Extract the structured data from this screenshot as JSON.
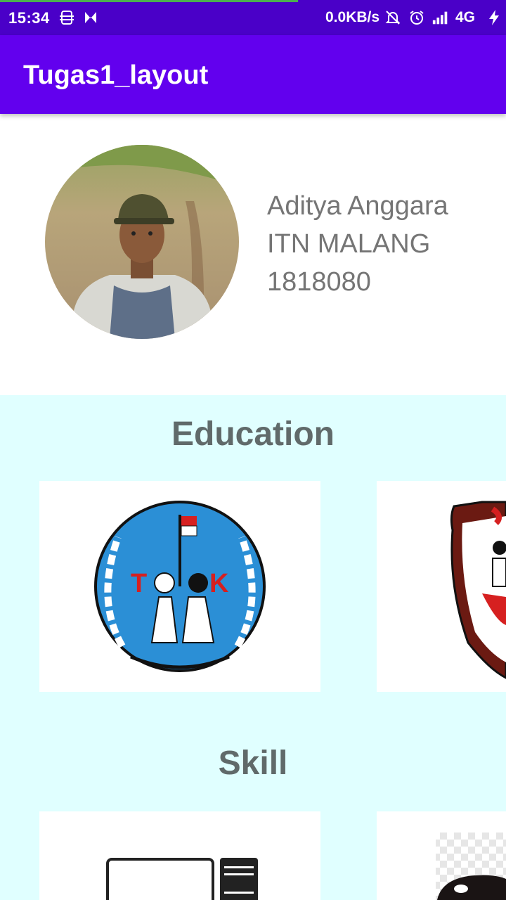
{
  "status_bar": {
    "time": "15:34",
    "network_speed": "0.0KB/s",
    "carrier": "4G"
  },
  "app_bar": {
    "title": "Tugas1_layout"
  },
  "profile": {
    "name": "Aditya Anggara",
    "school": "ITN MALANG",
    "student_id": "1818080"
  },
  "education": {
    "heading": "Education",
    "cards": [
      {
        "icon": "tk-kindergarten-emblem-icon",
        "emblem_letters": [
          "T",
          "K"
        ]
      },
      {
        "icon": "school-shield-emblem-icon"
      }
    ]
  },
  "skill": {
    "heading": "Skill",
    "cards": [
      {
        "icon": "computer-monitor-icon"
      },
      {
        "icon": "skill-logo-icon"
      }
    ]
  },
  "colors": {
    "status_bar": "#4a00c8",
    "app_bar": "#6200ee",
    "content_background": "#e0ffff",
    "heading_text": "#606a6a",
    "info_text": "#757575"
  }
}
